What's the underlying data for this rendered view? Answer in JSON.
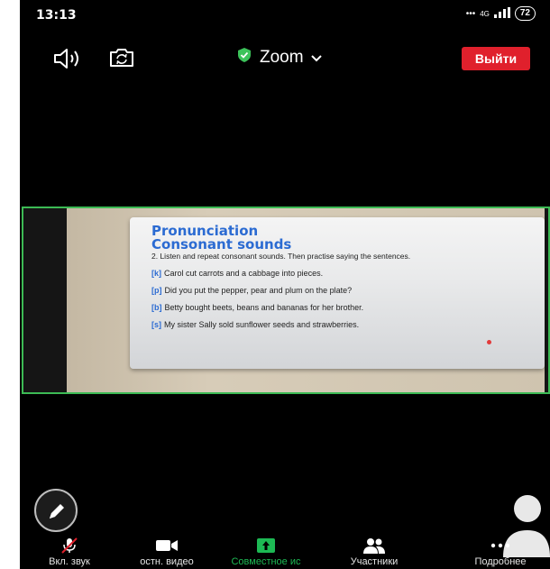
{
  "status_bar": {
    "time": "13:13",
    "network": "4G",
    "battery": "72"
  },
  "topbar": {
    "meeting_title": "Zoom",
    "leave_label": "Выйти"
  },
  "slide": {
    "title": "Pronunciation",
    "subtitle": "Consonant sounds",
    "instruction": "2. Listen and repeat consonant sounds. Then practise saying the sentences.",
    "lines": [
      {
        "code": "[k]",
        "text": "Carol cut carrots and a cabbage into pieces."
      },
      {
        "code": "[p]",
        "text": "Did you put the pepper, pear and plum on the plate?"
      },
      {
        "code": "[b]",
        "text": "Betty bought beets, beans and bananas for her brother."
      },
      {
        "code": "[s]",
        "text": "My sister Sally sold sunflower seeds and strawberries."
      }
    ]
  },
  "bottom_bar": {
    "mute": "Вкл. звук",
    "video": "остн. видео",
    "share": "Совместное ис",
    "participants": "Участники",
    "more": "Подробнее"
  },
  "colors": {
    "accent_green": "#1db954",
    "leave_red": "#e0202c",
    "slide_blue": "#2b6bd2"
  }
}
